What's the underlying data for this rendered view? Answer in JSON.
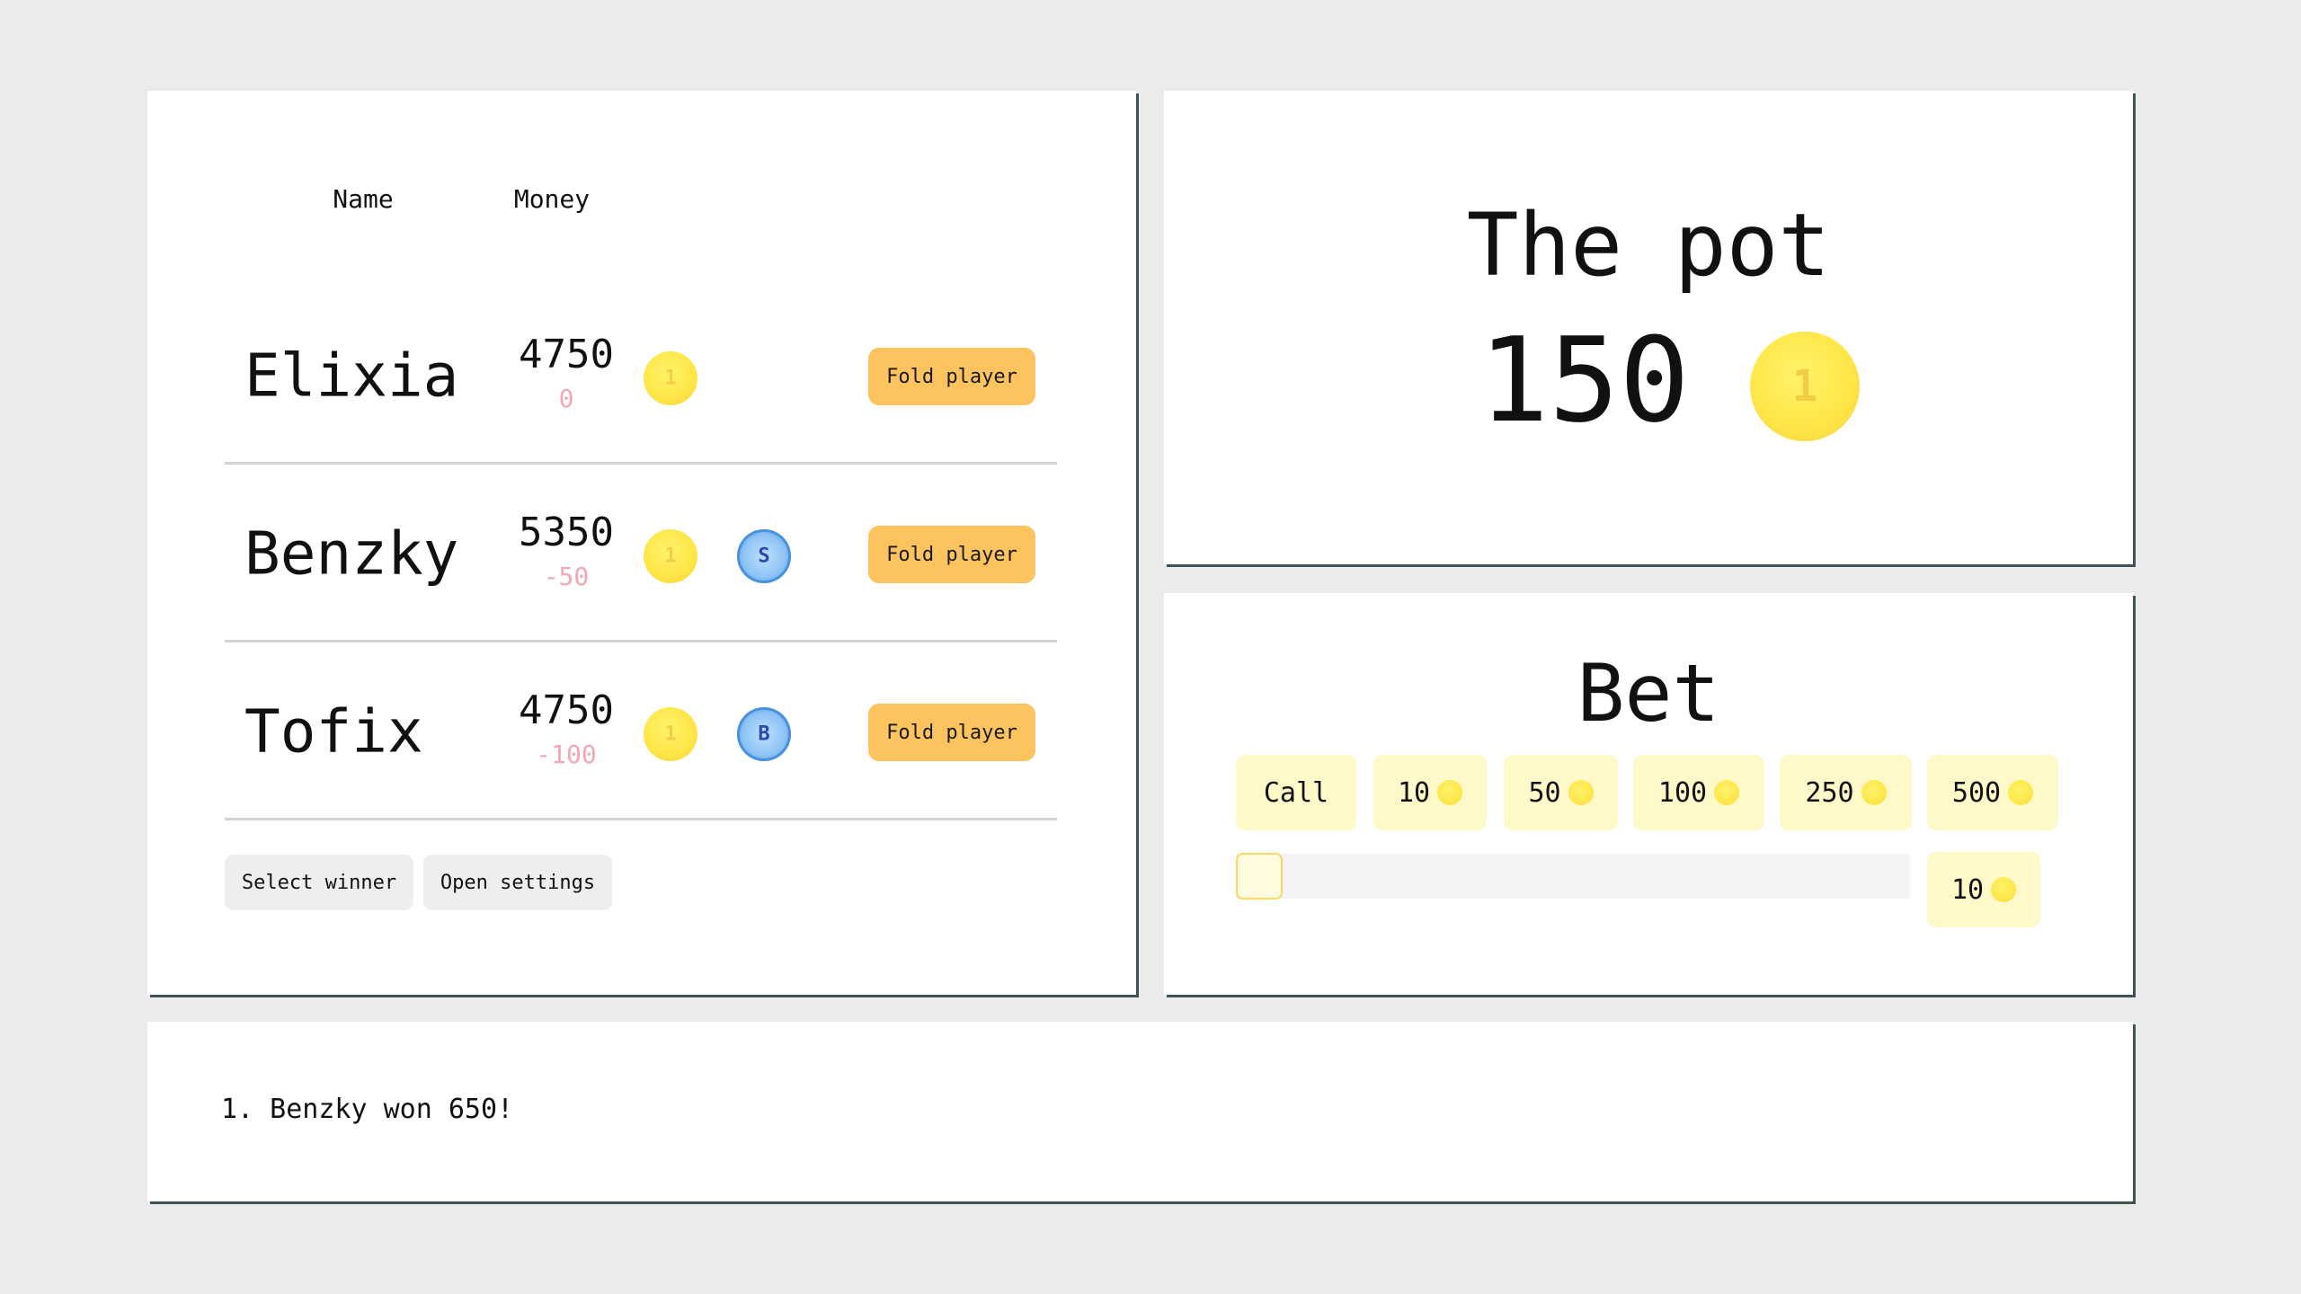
{
  "table": {
    "name_header": "Name",
    "money_header": "Money",
    "players": [
      {
        "name": "Elixia",
        "money": "4750",
        "delta": "0",
        "chips": [
          "1"
        ],
        "fold_label": "Fold player"
      },
      {
        "name": "Benzky",
        "money": "5350",
        "delta": "-50",
        "chips": [
          "1",
          "S"
        ],
        "fold_label": "Fold player"
      },
      {
        "name": "Tofix",
        "money": "4750",
        "delta": "-100",
        "chips": [
          "1",
          "B"
        ],
        "fold_label": "Fold player"
      }
    ],
    "select_winner_label": "Select winner",
    "open_settings_label": "Open settings"
  },
  "pot": {
    "title": "The pot",
    "amount": "150",
    "coin_label": "1"
  },
  "bet": {
    "title": "Bet",
    "call_label": "Call",
    "amounts": [
      "10",
      "50",
      "100",
      "250",
      "500"
    ],
    "slider_value": "10"
  },
  "log": {
    "entries": [
      "1. Benzky won 650!"
    ]
  },
  "colors": {
    "background": "#ebebeb",
    "fold_button": "#fdc35e",
    "bet_button": "#fff8c9",
    "delta_text": "#f4a6b5",
    "panel_shadow": "#3e5355"
  }
}
